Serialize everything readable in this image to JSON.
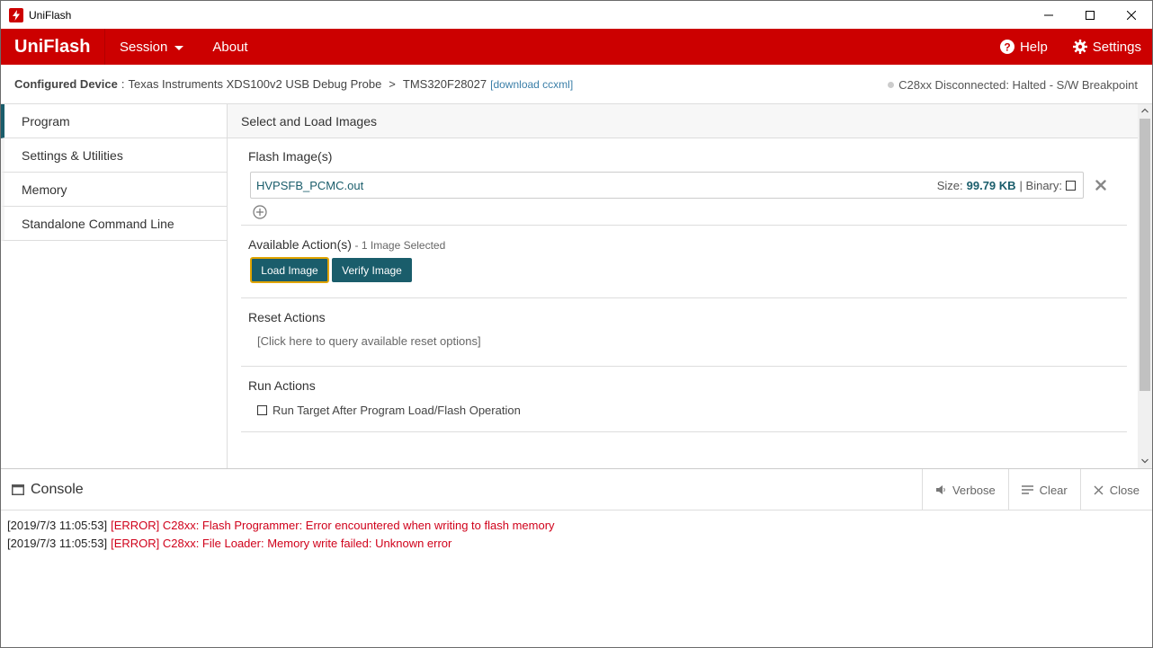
{
  "window": {
    "title": "UniFlash"
  },
  "menubar": {
    "brand": "UniFlash",
    "session": "Session",
    "about": "About",
    "help": "Help",
    "settings": "Settings",
    "accent_color": "#cc0000"
  },
  "config": {
    "label": "Configured Device",
    "separator": ":",
    "probe": "Texas Instruments XDS100v2 USB Debug Probe",
    "chevron": ">",
    "device": "TMS320F28027",
    "download_link": "[download ccxml]",
    "status": "C28xx Disconnected: Halted - S/W Breakpoint"
  },
  "sidebar": {
    "items": [
      {
        "label": "Program"
      },
      {
        "label": "Settings & Utilities"
      },
      {
        "label": "Memory"
      },
      {
        "label": "Standalone Command Line"
      }
    ]
  },
  "main": {
    "header": "Select and Load Images",
    "flash": {
      "title": "Flash Image(s)",
      "file_name": "HVPSFB_PCMC.out",
      "size_label": "Size:",
      "size_value": "99.79 KB",
      "binary_label": "| Binary:"
    },
    "actions": {
      "title": "Available Action(s)",
      "subtitle": "- 1 Image Selected",
      "load_button": "Load Image",
      "verify_button": "Verify Image"
    },
    "reset": {
      "title": "Reset Actions",
      "query_text": "[Click here to query available reset options]"
    },
    "run": {
      "title": "Run Actions",
      "checkbox_label": "Run Target After Program Load/Flash Operation"
    }
  },
  "console": {
    "title": "Console",
    "verbose": "Verbose",
    "clear": "Clear",
    "close": "Close",
    "lines": [
      {
        "time": "[2019/7/3 11:05:53]",
        "message": "[ERROR] C28xx: Flash Programmer: Error encountered when writing to flash memory"
      },
      {
        "time": "[2019/7/3 11:05:53]",
        "message": "[ERROR] C28xx: File Loader: Memory write failed: Unknown error"
      }
    ]
  }
}
